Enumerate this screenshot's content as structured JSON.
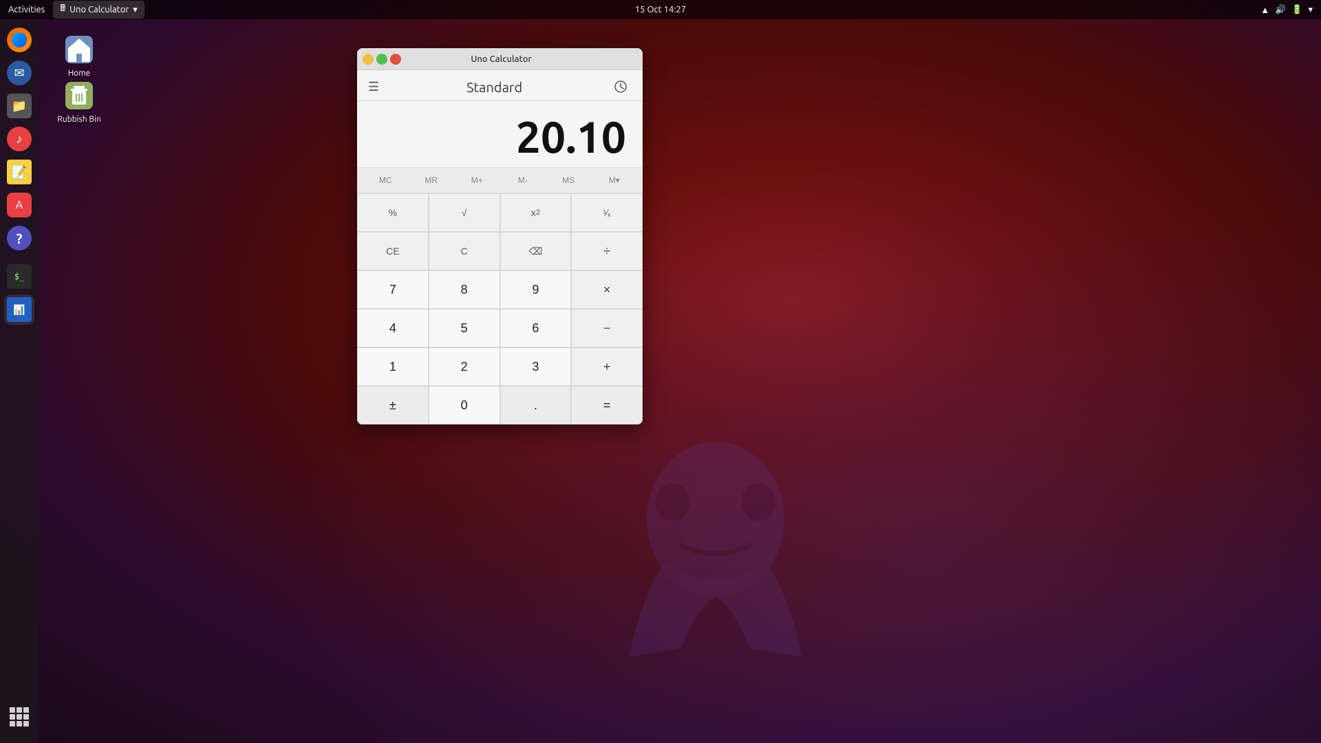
{
  "topbar": {
    "activities_label": "Activities",
    "app_label": "Uno Calculator",
    "datetime": "15 Oct  14:27",
    "chevron": "▾"
  },
  "desktop": {
    "icons": [
      {
        "id": "home",
        "label": "Home",
        "icon": "home"
      },
      {
        "id": "rubbish-bin",
        "label": "Rubbish Bin",
        "icon": "trash"
      }
    ]
  },
  "sidebar": {
    "items": [
      {
        "id": "firefox",
        "label": "Firefox"
      },
      {
        "id": "thunderbird",
        "label": "Thunderbird"
      },
      {
        "id": "files",
        "label": "Files"
      },
      {
        "id": "rhythmbox",
        "label": "Rhythmbox"
      },
      {
        "id": "notes",
        "label": "Notes"
      },
      {
        "id": "appstore",
        "label": "App Store"
      },
      {
        "id": "help",
        "label": "Help"
      },
      {
        "id": "terminal",
        "label": "Terminal"
      },
      {
        "id": "calc",
        "label": "Calc"
      }
    ]
  },
  "calculator": {
    "title": "Uno Calculator",
    "mode": "Standard",
    "display": "20.10",
    "history_label": "🕐",
    "memory_buttons": [
      "MC",
      "MR",
      "M+",
      "M-",
      "MS",
      "M▾"
    ],
    "buttons": [
      "%",
      "√",
      "x²",
      "¹∕ₓ",
      "CE",
      "C",
      "⌫",
      "÷",
      "7",
      "8",
      "9",
      "×",
      "4",
      "5",
      "6",
      "−",
      "1",
      "2",
      "3",
      "+",
      "±",
      "0",
      ".",
      "="
    ]
  }
}
